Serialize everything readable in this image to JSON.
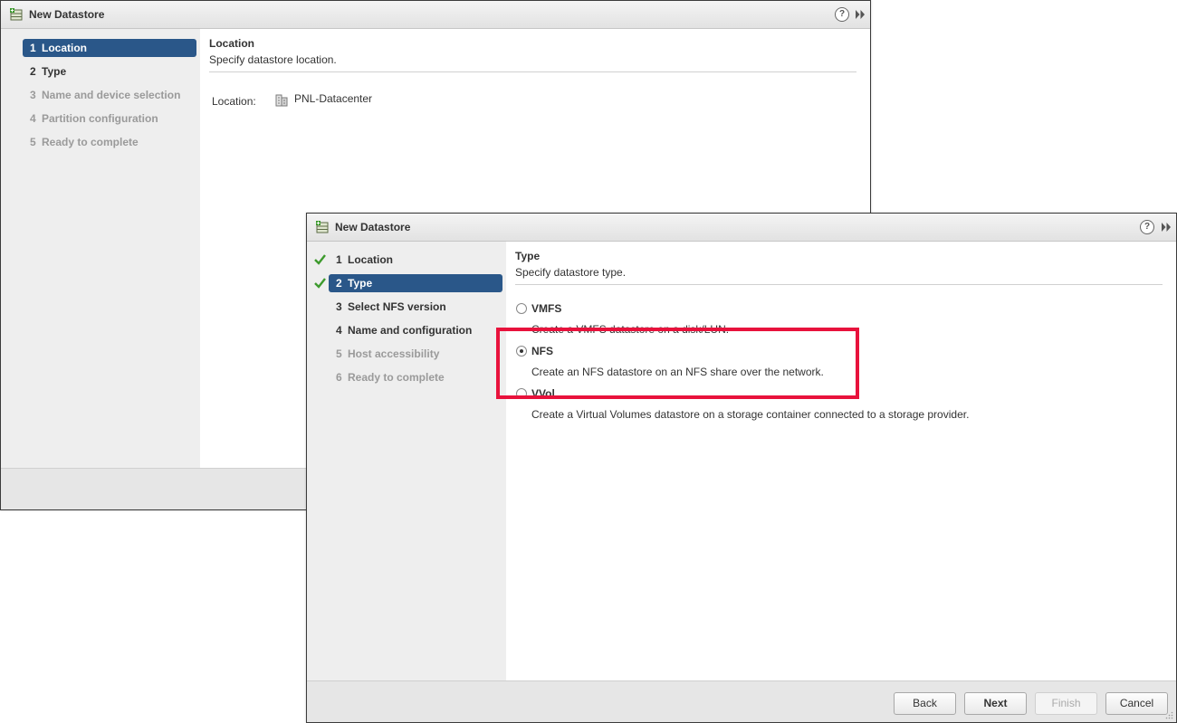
{
  "back_dialog": {
    "title": "New Datastore",
    "help_label": "?",
    "steps": [
      {
        "num": "1",
        "label": "Location"
      },
      {
        "num": "2",
        "label": "Type"
      },
      {
        "num": "3",
        "label": "Name and device selection"
      },
      {
        "num": "4",
        "label": "Partition configuration"
      },
      {
        "num": "5",
        "label": "Ready to complete"
      }
    ],
    "content": {
      "title": "Location",
      "subtitle": "Specify datastore location.",
      "location_label": "Location:",
      "location_value": "PNL-Datacenter"
    }
  },
  "front_dialog": {
    "title": "New Datastore",
    "help_label": "?",
    "steps": [
      {
        "num": "1",
        "label": "Location"
      },
      {
        "num": "2",
        "label": "Type"
      },
      {
        "num": "3",
        "label": "Select NFS version"
      },
      {
        "num": "4",
        "label": "Name and configuration"
      },
      {
        "num": "5",
        "label": "Host accessibility"
      },
      {
        "num": "6",
        "label": "Ready to complete"
      }
    ],
    "content": {
      "title": "Type",
      "subtitle": "Specify datastore type.",
      "options": [
        {
          "label": "VMFS",
          "description": "Create a VMFS datastore on a disk/LUN.",
          "selected": false
        },
        {
          "label": "NFS",
          "description": "Create an NFS datastore on an NFS share over the network.",
          "selected": true
        },
        {
          "label": "VVol",
          "description": "Create a Virtual Volumes datastore on a storage container connected to a storage provider.",
          "selected": false
        }
      ]
    },
    "buttons": {
      "back": "Back",
      "next": "Next",
      "finish": "Finish",
      "cancel": "Cancel"
    }
  },
  "colors": {
    "active_step": "#2a5789",
    "check": "#3d9a2d",
    "highlight": "#e8123c"
  }
}
